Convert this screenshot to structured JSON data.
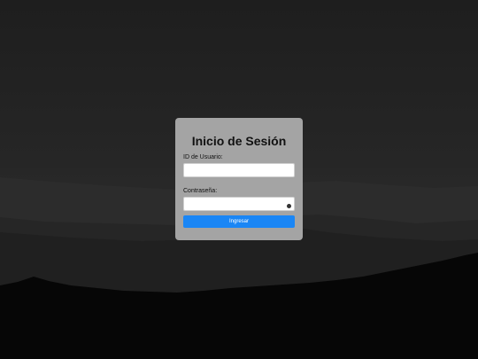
{
  "login": {
    "title": "Inicio de Sesión",
    "user_label": "ID de Usuario:",
    "user_value": "",
    "password_label": "Contraseña:",
    "password_value": "",
    "submit_label": "Ingresar"
  },
  "colors": {
    "card_background": "#a4a4a4",
    "button": "#1a86f5",
    "button_text": "#ffffff"
  },
  "icons": {
    "password_field": "password-key-icon"
  }
}
